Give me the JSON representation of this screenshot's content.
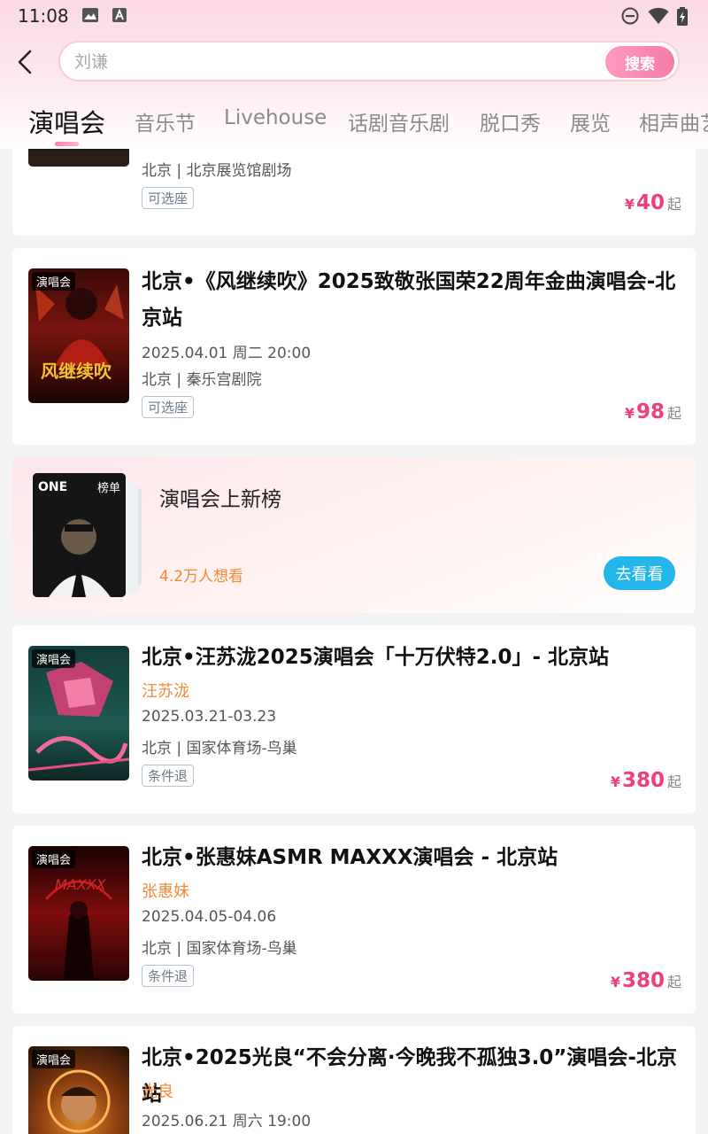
{
  "status_bar": {
    "time": "11:08"
  },
  "search": {
    "placeholder": "刘谦",
    "button_label": "搜索"
  },
  "tabs": [
    {
      "label": "演唱会",
      "active": true
    },
    {
      "label": "音乐节"
    },
    {
      "label": "Livehouse"
    },
    {
      "label": "话剧音乐剧"
    },
    {
      "label": "脱口秀"
    },
    {
      "label": "展览"
    },
    {
      "label": "相声曲艺"
    }
  ],
  "cards": [
    {
      "venue": "北京 | 北京展览馆剧场",
      "badge": "可选座",
      "price_currency": "¥",
      "price": "40",
      "price_suffix": "起"
    },
    {
      "tag": "演唱会",
      "title": "北京•《风继续吹》2025致敬张国荣22周年金曲演唱会-北京站",
      "date": "2025.04.01 周二 20:00",
      "venue": "北京 | 秦乐宫剧院",
      "badge": "可选座",
      "price_currency": "¥",
      "price": "98",
      "price_suffix": "起",
      "poster_text": "风继续吹"
    },
    {
      "tag": "演唱会",
      "title": "北京•汪苏泷2025演唱会「十万伏特2.0」- 北京站",
      "artist": "汪苏泷",
      "date": "2025.03.21-03.23",
      "venue": "北京 | 国家体育场-鸟巢",
      "badge": "条件退",
      "price_currency": "¥",
      "price": "380",
      "price_suffix": "起"
    },
    {
      "tag": "演唱会",
      "title": "北京•张惠妹ASMR MAXXX演唱会 - 北京站",
      "artist": "张惠妹",
      "date": "2025.04.05-04.06",
      "venue": "北京 | 国家体育场-鸟巢",
      "badge": "条件退",
      "price_currency": "¥",
      "price": "380",
      "price_suffix": "起",
      "poster_text": "MAXXX"
    },
    {
      "tag": "演唱会",
      "title": "北京•2025光良“不会分离·今晚我不孤独3.0”演唱会-北京站",
      "artist": "光良",
      "date": "2025.06.21 周六 19:00"
    }
  ],
  "ranking": {
    "title": "演唱会上新榜",
    "want_count": "4.2万人想看",
    "button_label": "去看看",
    "tag": "榜单",
    "poster_text": "ONE"
  },
  "colors": {
    "accent_pink": "#ee3f7a",
    "artist_orange": "#f08a3a",
    "button_blue": "#22b6ea"
  }
}
